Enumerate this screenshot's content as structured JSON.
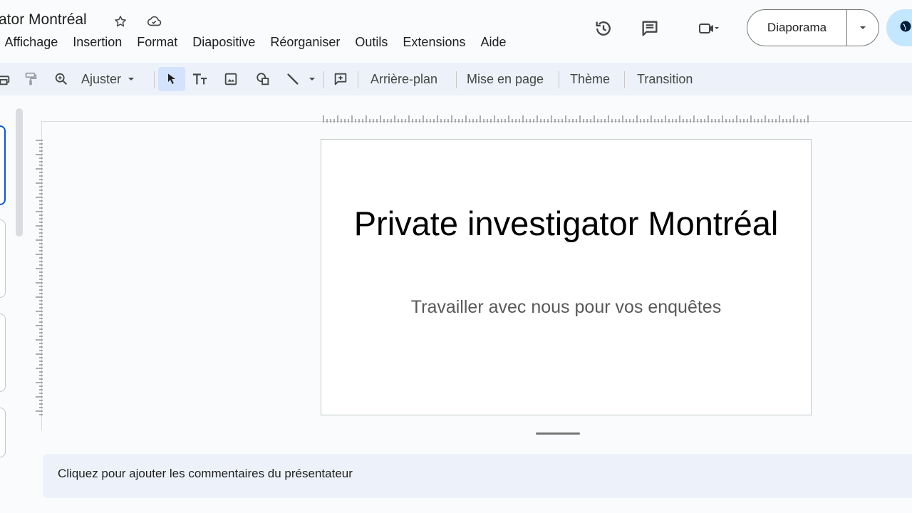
{
  "document": {
    "title": "ator Montréal",
    "star_icon": "star-icon",
    "cloud_status_icon": "cloud-done-icon"
  },
  "menu": {
    "items": [
      "Affichage",
      "Insertion",
      "Format",
      "Diapositive",
      "Réorganiser",
      "Outils",
      "Extensions",
      "Aide"
    ]
  },
  "header_actions": {
    "history_icon": "history-icon",
    "comments_icon": "comment-icon",
    "meet_icon": "video-camera-icon",
    "present_label": "Diaporama",
    "present_dropdown_icon": "chevron-down-icon",
    "share_icon": "globe-icon"
  },
  "toolbar": {
    "zoom_label": "Ajuster",
    "background_label": "Arrière-plan",
    "layout_label": "Mise en page",
    "theme_label": "Thème",
    "transition_label": "Transition",
    "text_tool_label": "Tт"
  },
  "slide": {
    "title": "Private investigator Montréal",
    "subtitle": "Travailler avec nous pour vos enquêtes"
  },
  "notes": {
    "placeholder": "Cliquez pour ajouter les commentaires du présentateur"
  },
  "colors": {
    "accent": "#0b57d0",
    "toolbar_bg": "#edf2fa",
    "share_bg": "#c2e7ff"
  }
}
